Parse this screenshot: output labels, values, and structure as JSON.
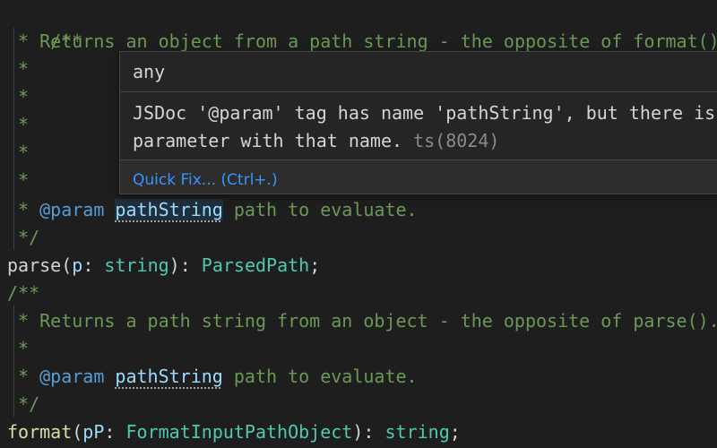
{
  "editor": {
    "lines": [
      {
        "indent": "",
        "star": "/**",
        "rest": ""
      },
      {
        "indent": " ",
        "star": "* ",
        "rest": "Returns an object from a path string - the opposite of format()."
      },
      {
        "indent": " ",
        "star": "*",
        "rest": ""
      },
      {
        "indent": " ",
        "star": "*",
        "rest": ""
      },
      {
        "indent": " ",
        "star": "*",
        "rest": ""
      },
      {
        "indent": " ",
        "star": "*",
        "rest": ""
      },
      {
        "indent": " ",
        "star": "*",
        "rest": ""
      }
    ],
    "param1": {
      "prefix": " * ",
      "tag": "@param",
      "name": "pathString",
      "desc": " path to evaluate."
    },
    "close1": " */",
    "parse_sig": {
      "fn": "parse",
      "open": "(",
      "param": "p",
      "colon": ": ",
      "ptype": "string",
      "close": "): ",
      "ret": "ParsedPath",
      "end": ";"
    },
    "open2": "/**",
    "returns2": " * Returns a path string from an object - the opposite of parse().",
    "star2": " *",
    "param2": {
      "prefix": " * ",
      "tag": "@param",
      "name": "pathString",
      "desc": " path to evaluate."
    },
    "close2": " */",
    "format_sig": {
      "fn": "format",
      "open": "(",
      "param": "pP",
      "colon": ": ",
      "ptype": "FormatInputPathObject",
      "close": "): ",
      "ret": "string",
      "end": ";"
    }
  },
  "hover": {
    "type_text": "any",
    "message_line1": "JSDoc '@param' tag has name 'pathString', but there is no",
    "message_line2": "parameter with that name. ",
    "error_code": "ts(8024)",
    "quick_fix_label": "Quick Fix... (Ctrl+.)"
  },
  "colors": {
    "background": "#1e1e1e",
    "comment": "#6a9955",
    "keyword_tag": "#569cd6",
    "identifier": "#9cdcfe",
    "type": "#4ec9b0",
    "function": "#dcdcaa",
    "link": "#3794ff"
  }
}
